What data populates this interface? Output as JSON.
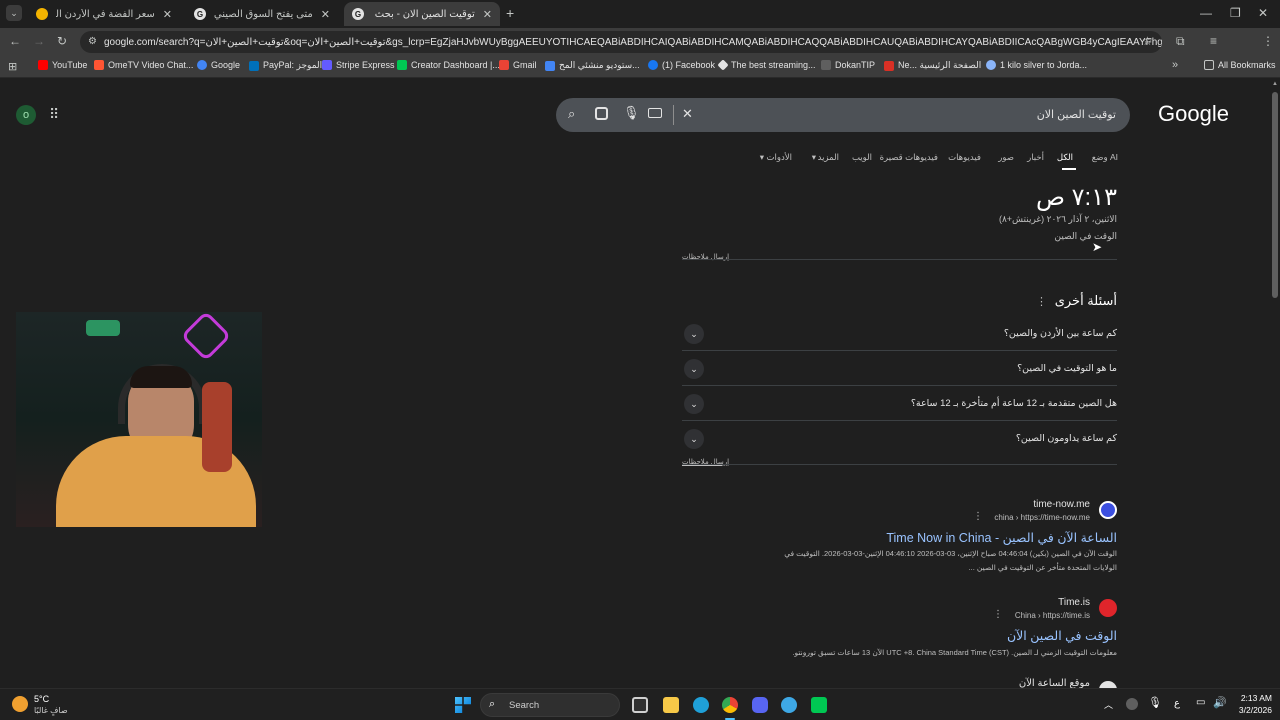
{
  "tabs": [
    {
      "title": "سعر الفضة في الأردن اليوم",
      "active": false
    },
    {
      "title": "متى يفتح السوق الصيني للتداول",
      "active": false
    },
    {
      "title": "توقيت الصين الان - بحث Google",
      "active": true
    }
  ],
  "omnibox": {
    "url": "google.com/search?q=توقيت+الصين+الان&oq=توقيت+الصين+الان&gs_lcrp=EgZjaHJvbWUyBggAEEUYOTIHCAEQABiABDIHCAIQABiABDIHCAMQABiABDIHCAQQABiABDIHCAUQABiABDIHCAYQABiABDIICAcQABgWGB4yCAgIEAAYFhgeMggICRAAGBYY..."
  },
  "bookmarks": [
    {
      "label": "YouTube",
      "color": "#ff0000"
    },
    {
      "label": "OmeTV Video Chat...",
      "color": "#ff5533"
    },
    {
      "label": "Google",
      "color": "#4285f4"
    },
    {
      "label": "PayPal: الموجز",
      "color": "#0070ba"
    },
    {
      "label": "Stripe Express",
      "color": "#635bff"
    },
    {
      "label": "Creator Dashboard |...",
      "color": "#00c853"
    },
    {
      "label": "Gmail",
      "color": "#ea4335"
    },
    {
      "label": "ستوديو منشئي المح...",
      "color": "#4285f4"
    },
    {
      "label": "(1) Facebook",
      "color": "#1877f2"
    },
    {
      "label": "The best streaming...",
      "color": "#e3e3e3"
    },
    {
      "label": "DokanTIP",
      "color": "#5f5f5f"
    },
    {
      "label": "Ne... الصفحة الرئيسية",
      "color": "#d93025"
    },
    {
      "label": "1 kilo silver to Jorda...",
      "color": "#8ab4f8"
    },
    {
      "label": "All Bookmarks",
      "color": "#c4c7c5"
    }
  ],
  "search": {
    "query": "توقيت الصين الان",
    "logo": "Google",
    "avatar_letter": "o"
  },
  "nav_tabs": [
    "وضع AI",
    "الكل",
    "أخبار",
    "صور",
    "فيديوهات",
    "فيديوهات قصيرة",
    "الويب",
    "المزيد",
    "الأدوات"
  ],
  "time_card": {
    "time": "٧:١٣ ص",
    "date": "الاثنين، ٢ آذار ٢٠٢٦ (غرينتش+٨)",
    "label": "الوقت في الصين",
    "feedback": "إرسال ملاحظات"
  },
  "paa": {
    "title": "أسئلة أخرى",
    "questions": [
      "كم ساعة بين الأردن والصين؟",
      "ما هو التوقيت في الصين؟",
      "هل الصين متقدمة بـ 12 ساعة أم متأخرة بـ 12 ساعة؟",
      "كم ساعة يداومون الصين؟"
    ],
    "feedback": "إرسال ملاحظات"
  },
  "results": [
    {
      "site": "time-now.me",
      "url": "china › https://time-now.me",
      "title": "الساعة الآن في الصين - Time Now in China",
      "snippet1": "الوقت الآن في الصين (بكين) 04:46:04 صباح الإثنين، 03-03-2026 04:46:10 الإثنين-03-03-2026. التوقيت في",
      "snippet2": "الولايات المتحدة متأخر عن التوقيت في الصين ...",
      "fav_color": "#3c4fe0"
    },
    {
      "site": "Time.is",
      "url": "China › https://time.is",
      "title": "الوقت في الصين الآن",
      "snippet1": "معلومات التوقيت الزمني لـ الصين. UTC +8. China Standard Time (CST) الآن 13 ساعات تسبق تورونتو.",
      "snippet2": "",
      "fav_color": "#e0252b"
    },
    {
      "site": "موقع الساعة الآن",
      "url": "",
      "title": "",
      "snippet1": "",
      "snippet2": "",
      "fav_color": "#e3e3e3"
    }
  ],
  "taskbar": {
    "weather_temp": "5°C",
    "weather_desc": "صافٍ غالبًا",
    "search_label": "Search",
    "lang": "ع",
    "time": "2:13 AM",
    "date": "3/2/2026"
  },
  "colors": {
    "link": "#99c3ff",
    "text_muted": "#bfbfbf"
  }
}
